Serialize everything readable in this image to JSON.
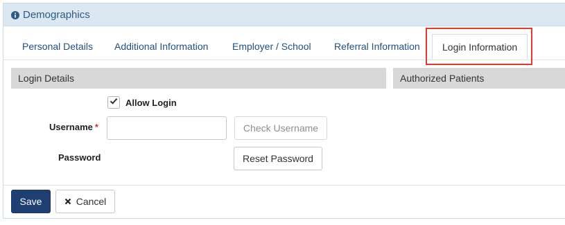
{
  "panel": {
    "title": "Demographics",
    "icon": "info-circle-icon"
  },
  "tabs": [
    {
      "label": "Personal Details"
    },
    {
      "label": "Additional Information"
    },
    {
      "label": "Employer / School"
    },
    {
      "label": "Referral Information"
    },
    {
      "label": "Login Information",
      "active": true
    }
  ],
  "sections": {
    "login_details": "Login Details",
    "authorized_patients": "Authorized Patients"
  },
  "form": {
    "allow_login_label": "Allow Login",
    "allow_login_checked": true,
    "username_label": "Username",
    "username_required_mark": "*",
    "username_value": "",
    "check_username_label": "Check Username",
    "password_label": "Password",
    "reset_password_label": "Reset Password"
  },
  "footer": {
    "save_label": "Save",
    "cancel_label": "Cancel",
    "cancel_icon": "close-icon"
  },
  "colors": {
    "header_bg": "#dbe8f2",
    "primary": "#1f3f73",
    "highlight": "#e3392b",
    "link": "#1f4f82"
  }
}
